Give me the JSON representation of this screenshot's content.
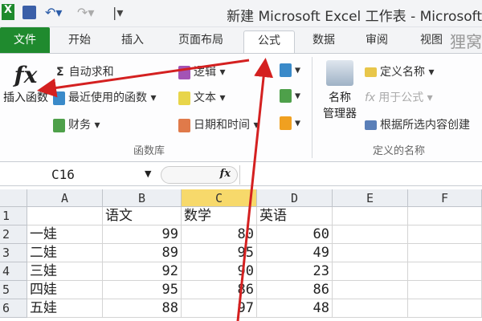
{
  "titlebar": {
    "title": "新建 Microsoft Excel 工作表 - Microsoft",
    "app_icon": "X",
    "save_icon": "save-icon",
    "undo_icon": "undo-icon",
    "redo_icon": "redo-icon"
  },
  "tabs": [
    "文件",
    "开始",
    "插入",
    "页面布局",
    "公式",
    "数据",
    "审阅",
    "视图"
  ],
  "watermark": "狸窝",
  "ribbon": {
    "insert_function": {
      "icon": "fx",
      "label": "插入函数"
    },
    "autosum": "自动求和",
    "recent": "最近使用的函数",
    "financial": "财务",
    "logical": "逻辑",
    "text": "文本",
    "datetime": "日期和时间",
    "library_label": "函数库",
    "name_manager": [
      "名称",
      "管理器"
    ],
    "define_name": "定义名称",
    "use_in_formula": "用于公式",
    "create_from_selection": "根据所选内容创建",
    "names_label": "定义的名称"
  },
  "formula_bar": {
    "name_box": "C16",
    "fx": "fx",
    "value": ""
  },
  "grid": {
    "columns": [
      "A",
      "B",
      "C",
      "D",
      "E",
      "F"
    ],
    "selected_column": "C",
    "rows": [
      {
        "n": "1",
        "cells": [
          "",
          "语文",
          "数学",
          "英语",
          "",
          ""
        ]
      },
      {
        "n": "2",
        "cells": [
          "一娃",
          "99",
          "80",
          "60",
          "",
          ""
        ]
      },
      {
        "n": "3",
        "cells": [
          "二娃",
          "89",
          "95",
          "49",
          "",
          ""
        ]
      },
      {
        "n": "4",
        "cells": [
          "三娃",
          "92",
          "90",
          "23",
          "",
          ""
        ]
      },
      {
        "n": "5",
        "cells": [
          "四娃",
          "95",
          "86",
          "86",
          "",
          ""
        ]
      },
      {
        "n": "6",
        "cells": [
          "五娃",
          "88",
          "97",
          "48",
          "",
          ""
        ]
      }
    ]
  },
  "annotation_color": "#d42020"
}
